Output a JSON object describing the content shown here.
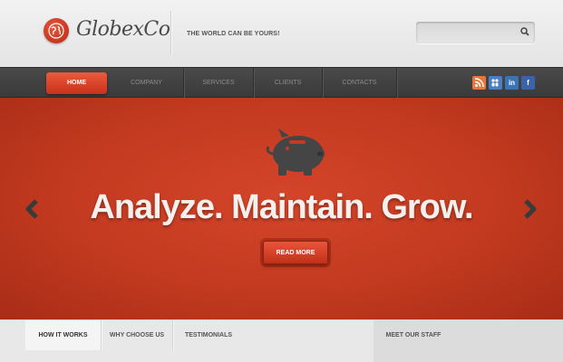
{
  "header": {
    "logo_text": "GlobexCo",
    "tagline": "THE WORLD CAN BE YOURS!",
    "search": {
      "placeholder": "",
      "value": ""
    }
  },
  "nav": {
    "items": [
      {
        "label": "HOME",
        "active": true
      },
      {
        "label": "COMPANY",
        "active": false
      },
      {
        "label": "SERVICES",
        "active": false
      },
      {
        "label": "CLIENTS",
        "active": false
      },
      {
        "label": "CONTACTS",
        "active": false
      }
    ],
    "social": [
      {
        "icon": "rss-icon",
        "glyph": "",
        "color": "#e7763b"
      },
      {
        "icon": "myspace-icon",
        "glyph": "",
        "color": "#4a7fc1"
      },
      {
        "icon": "linkedin-icon",
        "glyph": "in",
        "color": "#3a74b5"
      },
      {
        "icon": "facebook-icon",
        "glyph": "f",
        "color": "#3b63a8"
      }
    ]
  },
  "hero": {
    "headline": "Analyze. Maintain. Grow.",
    "read_more": "READ MORE",
    "icon": "piggy-bank-icon"
  },
  "tabs": [
    {
      "label": "HOW IT WORKS",
      "active": true
    },
    {
      "label": "WHY CHOOSE US",
      "active": false
    },
    {
      "label": "TESTIMONIALS",
      "active": false
    }
  ],
  "staff": {
    "label": "MEET OUR STAFF"
  },
  "colors": {
    "accent": "#d4452a",
    "nav_bg": "#414141",
    "header_bg": "#ececec"
  }
}
